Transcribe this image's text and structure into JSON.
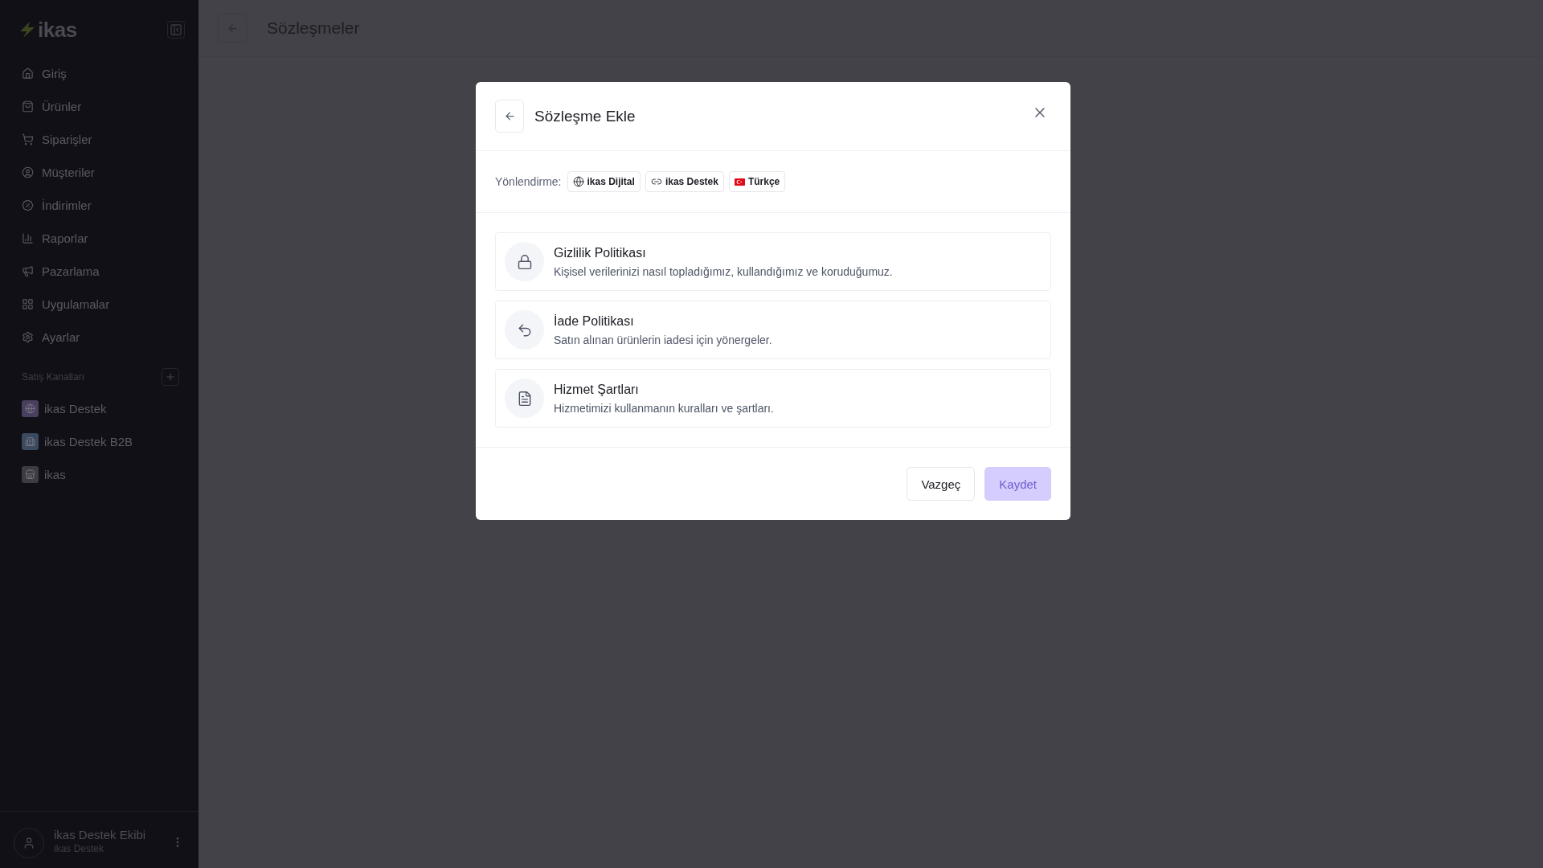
{
  "sidebar": {
    "logo": "ikas",
    "nav": [
      {
        "label": "Giriş"
      },
      {
        "label": "Ürünler"
      },
      {
        "label": "Siparişler"
      },
      {
        "label": "Müşteriler"
      },
      {
        "label": "İndirimler"
      },
      {
        "label": "Raporlar"
      },
      {
        "label": "Pazarlama"
      },
      {
        "label": "Uygulamalar"
      },
      {
        "label": "Ayarlar"
      }
    ],
    "channels_heading": "Satış Kanalları",
    "channels": [
      {
        "label": "ikas Destek",
        "color": "#48405e"
      },
      {
        "label": "ikas Destek B2B",
        "color": "#3b4a5e"
      },
      {
        "label": "ikas",
        "color": "#3c3c44"
      }
    ],
    "user": {
      "name": "ikas Destek Ekibi",
      "store": "ikas Destek"
    }
  },
  "page": {
    "title": "Sözleşmeler"
  },
  "dialog": {
    "title": "Sözleşme Ekle",
    "routing_label": "Yönlendirme:",
    "chips": [
      {
        "label": "ikas Dijital",
        "kind": "site"
      },
      {
        "label": "ikas Destek",
        "kind": "link"
      },
      {
        "label": "Türkçe",
        "kind": "language"
      }
    ],
    "options": [
      {
        "title": "Gizlilik Politikası",
        "description": "Kişisel verilerinizi nasıl topladığımız, kullandığımız ve koruduğumuz."
      },
      {
        "title": "İade Politikası",
        "description": "Satın alınan ürünlerin iadesi için yönergeler."
      },
      {
        "title": "Hizmet Şartları",
        "description": "Hizmetimizi kullanmanın kuralları ve şartları."
      }
    ],
    "buttons": [
      {
        "label": "Vazgeç",
        "kind": "secondary",
        "disabled": false
      },
      {
        "label": "Kaydet",
        "kind": "primary",
        "disabled": true
      }
    ]
  }
}
